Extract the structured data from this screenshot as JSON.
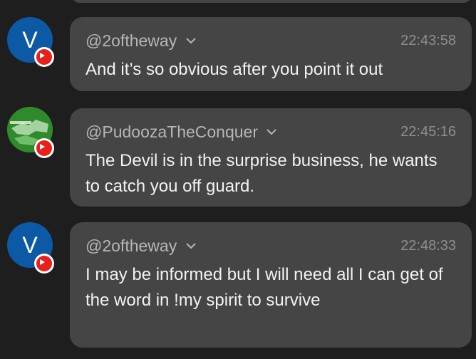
{
  "messages": [
    {
      "author": "@2oftheway",
      "time": "22:43:58",
      "text": "And it’s so obvious after you point it out",
      "avatar_letter": "V"
    },
    {
      "author": "@PudoozaTheConquer",
      "time": "22:45:16",
      "text": "The Devil is in the surprise business, he wants to catch you off guard."
    },
    {
      "author": "@2oftheway",
      "time": "22:48:33",
      "text": "I may be informed but I will need all I can get of the word in !my spirit to survive",
      "avatar_letter": "V"
    }
  ],
  "icons": {
    "badge": "youtube-icon",
    "author_menu": "chevron-down-icon"
  },
  "colors": {
    "background": "#1e1e1e",
    "bubble": "#454545",
    "avatar_blue": "#0c5aa6",
    "youtube_red": "#e8201c"
  }
}
